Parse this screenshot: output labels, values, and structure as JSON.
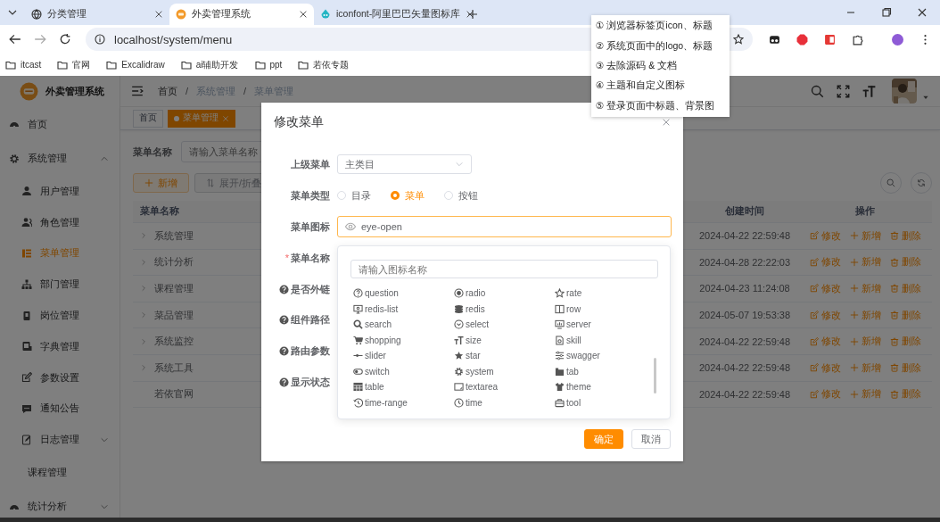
{
  "browser": {
    "tabs": [
      {
        "title": "分类管理",
        "selected": false
      },
      {
        "title": "外卖管理系统",
        "selected": true
      },
      {
        "title": "iconfont-阿里巴巴矢量图标库",
        "selected": false
      }
    ],
    "address": "localhost/system/menu",
    "bookmarks": [
      "itcast",
      "官网",
      "Excalidraw",
      "ai辅助开发",
      "ppt",
      "若依专题"
    ]
  },
  "annotation_menu": [
    "① 浏览器标签页icon、标题",
    "② 系统页面中的logo、标题",
    "③ 去除源码 & 文档",
    "④ 主题和自定义图标",
    "⑤ 登录页面中标题、背景图"
  ],
  "sidebar": {
    "title": "外卖管理系统",
    "items": [
      {
        "label": "首页",
        "selected": false
      },
      {
        "label": "系统管理",
        "selected": false,
        "expanded": true,
        "children": [
          {
            "label": "用户管理",
            "selected": false
          },
          {
            "label": "角色管理",
            "selected": false
          },
          {
            "label": "菜单管理",
            "selected": true
          },
          {
            "label": "部门管理",
            "selected": false
          },
          {
            "label": "岗位管理",
            "selected": false
          },
          {
            "label": "字典管理",
            "selected": false
          },
          {
            "label": "参数设置",
            "selected": false
          },
          {
            "label": "通知公告",
            "selected": false
          },
          {
            "label": "日志管理",
            "selected": false,
            "expanded": false
          }
        ]
      },
      {
        "label": "课程管理",
        "selected": false
      },
      {
        "label": "统计分析",
        "selected": false,
        "expanded": false
      }
    ]
  },
  "header": {
    "breadcrumb": [
      "首页",
      "系统管理",
      "菜单管理"
    ],
    "breadcrumb_separator": "/"
  },
  "tags": [
    {
      "label": "首页",
      "selected": false
    },
    {
      "label": "菜单管理",
      "selected": true
    }
  ],
  "search": {
    "label": "菜单名称",
    "placeholder": "请输入菜单名称"
  },
  "toolbar": [
    {
      "label": "新增",
      "kind": "add"
    },
    {
      "label": "展开/折叠",
      "kind": "expand"
    }
  ],
  "table": {
    "columns": [
      "菜单名称",
      "创建时间",
      "操作"
    ],
    "rows": [
      {
        "name": "系统管理",
        "expandable": true,
        "created": "2024-04-22 22:59:48",
        "actions": [
          {
            "kind": "edit",
            "label": "修改"
          },
          {
            "kind": "add",
            "label": "新增"
          },
          {
            "kind": "delete",
            "label": "删除"
          }
        ]
      },
      {
        "name": "统计分析",
        "expandable": true,
        "created": "2024-04-28 22:22:03",
        "actions": [
          {
            "kind": "edit",
            "label": "修改"
          },
          {
            "kind": "add",
            "label": "新增"
          },
          {
            "kind": "delete",
            "label": "删除"
          }
        ]
      },
      {
        "name": "课程管理",
        "expandable": true,
        "created": "2024-04-23 11:24:08",
        "actions": [
          {
            "kind": "edit",
            "label": "修改"
          },
          {
            "kind": "add",
            "label": "新增"
          },
          {
            "kind": "delete",
            "label": "删除"
          }
        ]
      },
      {
        "name": "菜品管理",
        "expandable": true,
        "created": "2024-05-07 19:53:38",
        "actions": [
          {
            "kind": "edit",
            "label": "修改"
          },
          {
            "kind": "add",
            "label": "新增"
          },
          {
            "kind": "delete",
            "label": "删除"
          }
        ]
      },
      {
        "name": "系统监控",
        "expandable": true,
        "created": "2024-04-22 22:59:48",
        "actions": [
          {
            "kind": "edit",
            "label": "修改"
          },
          {
            "kind": "add",
            "label": "新增"
          },
          {
            "kind": "delete",
            "label": "删除"
          }
        ]
      },
      {
        "name": "系统工具",
        "expandable": true,
        "created": "2024-04-22 22:59:48",
        "actions": [
          {
            "kind": "edit",
            "label": "修改"
          },
          {
            "kind": "add",
            "label": "新增"
          },
          {
            "kind": "delete",
            "label": "删除"
          }
        ]
      },
      {
        "name": "若依官网",
        "expandable": false,
        "created": "2024-04-22 22:59:48",
        "actions": [
          {
            "kind": "edit",
            "label": "修改"
          },
          {
            "kind": "add",
            "label": "新增"
          },
          {
            "kind": "delete",
            "label": "删除"
          }
        ]
      }
    ]
  },
  "dialog": {
    "title": "修改菜单",
    "fields": [
      {
        "label": "上级菜单",
        "kind": "select",
        "value": "主类目"
      },
      {
        "label": "菜单类型",
        "kind": "radio",
        "options": [
          {
            "label": "目录",
            "selected": false
          },
          {
            "label": "菜单",
            "selected": true
          },
          {
            "label": "按钮",
            "selected": false
          }
        ]
      },
      {
        "label": "菜单图标",
        "kind": "icon",
        "value": "eye-open"
      },
      {
        "label": "菜单名称",
        "kind": "text",
        "required_mark": "*"
      },
      {
        "label": "是否外链",
        "kind": "hint"
      },
      {
        "label": "组件路径",
        "kind": "hint"
      },
      {
        "label": "路由参数",
        "kind": "hint"
      },
      {
        "label": "显示状态",
        "kind": "hint"
      }
    ],
    "icon_picker": {
      "placeholder": "请输入图标名称",
      "icons": [
        "question",
        "radio",
        "rate",
        "redis-list",
        "redis",
        "row",
        "search",
        "select",
        "server",
        "shopping",
        "size",
        "skill",
        "slider",
        "star",
        "swagger",
        "switch",
        "system",
        "tab",
        "table",
        "textarea",
        "theme",
        "time-range",
        "time",
        "tool"
      ]
    },
    "buttons": [
      {
        "label": "确定",
        "kind": "primary"
      },
      {
        "label": "取消",
        "kind": "default"
      }
    ]
  }
}
